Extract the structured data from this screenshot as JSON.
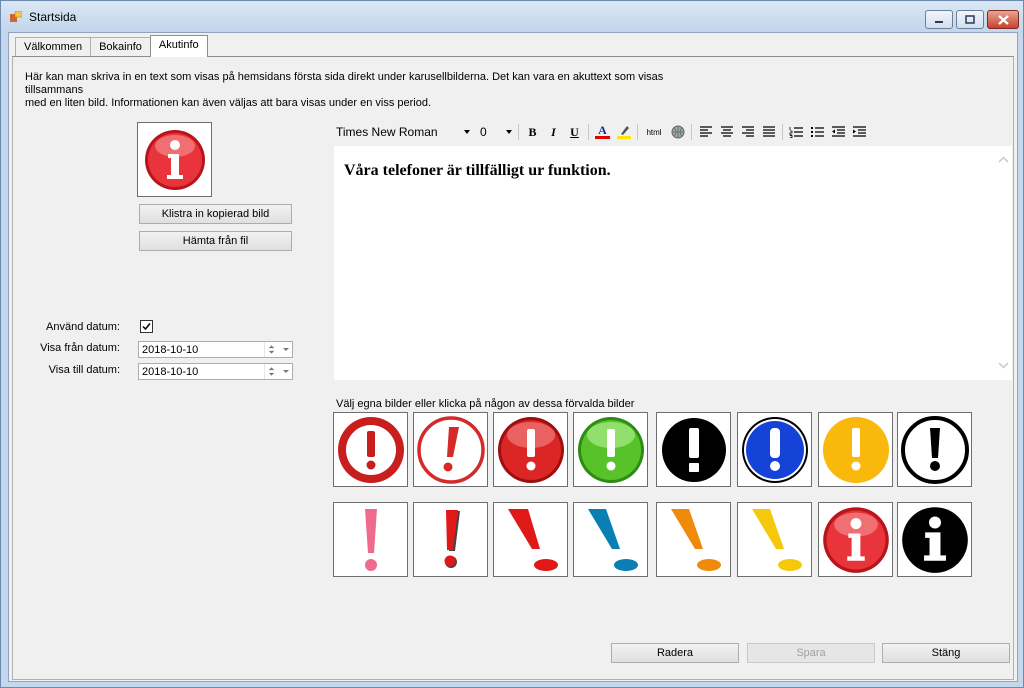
{
  "window": {
    "title": "Startsida"
  },
  "tabs": [
    {
      "label": "Välkommen"
    },
    {
      "label": "Bokainfo"
    },
    {
      "label": "Akutinfo"
    }
  ],
  "description": {
    "line1": "Här kan man skriva in en text som visas på hemsidans första sida direkt under karusellbilderna. Det kan vara en akuttext som visas tillsammans",
    "line2": "med en liten bild. Informationen kan även väljas att bara visas under en viss period."
  },
  "image_buttons": {
    "paste": "Klistra in kopierad bild",
    "from_file": "Hämta från fil"
  },
  "date_settings": {
    "use_date_label": "Använd datum:",
    "use_date_checked": true,
    "from_label": "Visa från datum:",
    "from_value": "2018-10-10",
    "to_label": "Visa till datum:",
    "to_value": "2018-10-10"
  },
  "toolbar": {
    "font": "Times New Roman",
    "size": "0",
    "bold": "B",
    "italic": "I",
    "underline": "U",
    "font_color": "A",
    "html": "html"
  },
  "editor": {
    "content": "Våra telefoner är tillfälligt ur funktion."
  },
  "presets": {
    "label": "Välj egna bilder eller klicka på någon av dessa förvalda bilder"
  },
  "footer": {
    "delete": "Radera",
    "save": "Spara",
    "close": "Stäng"
  }
}
